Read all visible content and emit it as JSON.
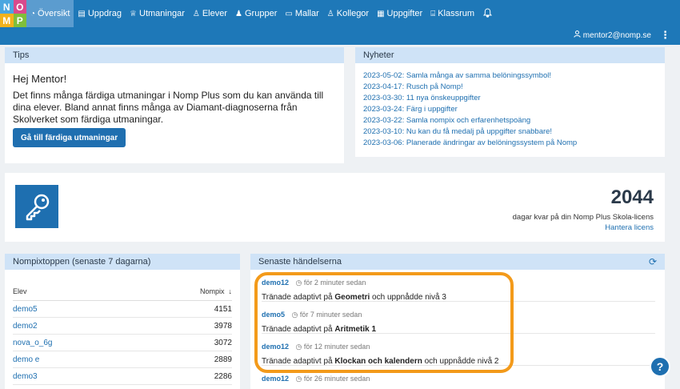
{
  "logo": {
    "letters": [
      "N",
      "O",
      "M",
      "P"
    ],
    "colors": [
      "#4aa6e0",
      "#d94a8c",
      "#f3b21c",
      "#7fbf3a"
    ]
  },
  "nav": {
    "items": [
      {
        "label": "Översikt",
        "icon": "gauge-icon",
        "glyph": "◔",
        "active": true
      },
      {
        "label": "Uppdrag",
        "icon": "book-icon",
        "glyph": "▤"
      },
      {
        "label": "Utmaningar",
        "icon": "trophy-icon",
        "glyph": "♕"
      },
      {
        "label": "Elever",
        "icon": "user-icon",
        "glyph": "♙"
      },
      {
        "label": "Grupper",
        "icon": "users-icon",
        "glyph": "♟"
      },
      {
        "label": "Mallar",
        "icon": "folder-icon",
        "glyph": "▭"
      },
      {
        "label": "Kollegor",
        "icon": "colleagues-icon",
        "glyph": "♙"
      },
      {
        "label": "Uppgifter",
        "icon": "table-icon",
        "glyph": "▦"
      },
      {
        "label": "Klassrum",
        "icon": "classroom-icon",
        "glyph": "⌸"
      }
    ],
    "bell_icon": "bell-icon"
  },
  "user": {
    "email": "mentor2@nomp.se",
    "icon": "user-icon",
    "menu_icon": "kebab-icon"
  },
  "tips": {
    "title": "Tips",
    "greeting": "Hej Mentor!",
    "body": "Det finns många färdiga utmaningar i Nomp Plus som du kan använda till dina elever. Bland annat finns många av Diamant-diagnoserna från Skolverket som färdiga utmaningar.",
    "button": "Gå till färdiga utmaningar"
  },
  "news": {
    "title": "Nyheter",
    "items": [
      "2023-05-02: Samla många av samma belöningssymbol!",
      "2023-04-17: Rusch på Nomp!",
      "2023-03-30: 11 nya önskeuppgifter",
      "2023-03-24: Färg i uppgifter",
      "2023-03-22: Samla nompix och erfarenhetspoäng",
      "2023-03-10: Nu kan du få medalj på uppgifter snabbare!",
      "2023-03-06: Planerade ändringar av belöningssystem på Nomp"
    ]
  },
  "license": {
    "icon": "key-icon",
    "days": "2044",
    "label": "dagar kvar på din Nomp Plus Skola-licens",
    "manage": "Hantera licens"
  },
  "toplist": {
    "title": "Nompixtoppen (senaste 7 dagarna)",
    "col_student": "Elev",
    "col_points": "Nompix",
    "sort_icon": "arrow-down-icon",
    "rows": [
      {
        "name": "demo5",
        "points": "4151"
      },
      {
        "name": "demo2",
        "points": "3978"
      },
      {
        "name": "nova_o_6g",
        "points": "3072"
      },
      {
        "name": "demo e",
        "points": "2889"
      },
      {
        "name": "demo3",
        "points": "2286"
      }
    ]
  },
  "events": {
    "title": "Senaste händelserna",
    "refresh_icon": "refresh-icon",
    "items": [
      {
        "user": "demo12",
        "time": "för 2 minuter sedan",
        "pre": "Tränade adaptivt på ",
        "topic": "Geometri",
        "post": " och uppnådde nivå 3"
      },
      {
        "user": "demo5",
        "time": "för 7 minuter sedan",
        "pre": "Tränade adaptivt på ",
        "topic": "Aritmetik 1",
        "post": ""
      },
      {
        "user": "demo12",
        "time": "för 12 minuter sedan",
        "pre": "Tränade adaptivt på ",
        "topic": "Klockan och kalendern",
        "post": " och uppnådde nivå 2"
      },
      {
        "user": "demo12",
        "time": "för 26 minuter sedan",
        "pre": "",
        "topic": "",
        "post": ""
      }
    ]
  },
  "highlight_color": "#f39a1a",
  "help": {
    "label": "?",
    "icon": "help-icon"
  }
}
